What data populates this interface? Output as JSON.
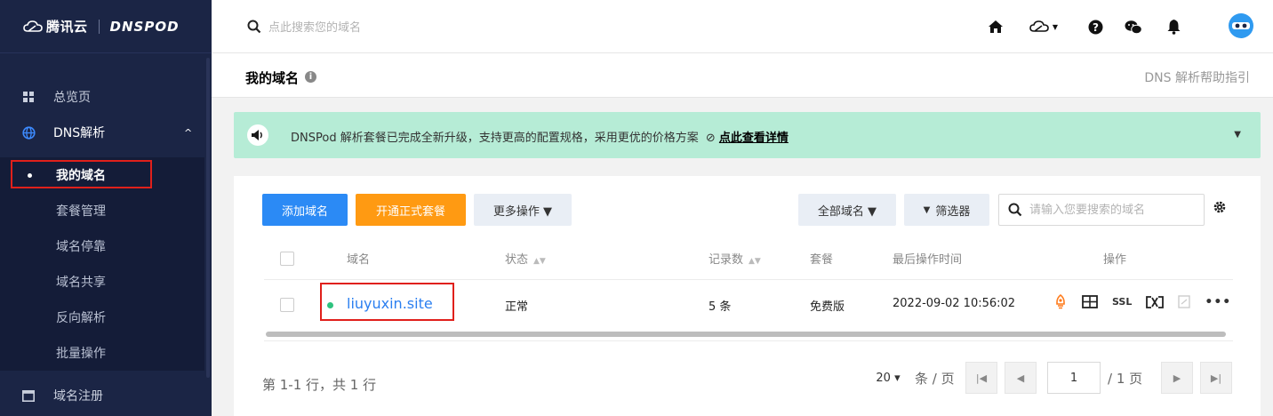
{
  "sidebar": {
    "brand": "腾讯云",
    "product": "DNSPOD",
    "items": [
      {
        "label": "总览页",
        "icon": "grid-icon"
      },
      {
        "label": "DNS解析",
        "icon": "globe-icon"
      },
      {
        "label": "域名注册",
        "icon": "window-icon"
      }
    ],
    "sub_items": [
      {
        "label": "我的域名"
      },
      {
        "label": "套餐管理"
      },
      {
        "label": "域名停靠"
      },
      {
        "label": "域名共享"
      },
      {
        "label": "反向解析"
      },
      {
        "label": "批量操作"
      }
    ]
  },
  "topbar": {
    "search_placeholder": "点此搜索您的域名"
  },
  "page": {
    "title": "我的域名",
    "help_link": "DNS 解析帮助指引"
  },
  "notice": {
    "text": "DNSPod 解析套餐已完成全新升级，支持更高的配置规格，采用更优的价格方案",
    "link": "点此查看详情"
  },
  "toolbar": {
    "add_domain": "添加域名",
    "open_plan": "开通正式套餐",
    "more_actions": "更多操作 ▼",
    "all_domains": "全部域名 ▼",
    "filter": "筛选器",
    "search_placeholder": "请输入您要搜索的域名"
  },
  "table": {
    "headers": {
      "domain": "域名",
      "status": "状态",
      "records": "记录数",
      "plan": "套餐",
      "last_op": "最后操作时间",
      "actions": "操作"
    },
    "rows": [
      {
        "domain": "liuyuxin.site",
        "status": "正常",
        "records": "5 条",
        "plan": "免费版",
        "last_op": "2022-09-02 10:56:02",
        "ssl": "SSL"
      }
    ]
  },
  "pager": {
    "summary": "第 1-1 行，共 1 行",
    "page_size": "20 ▾",
    "per_page": "条 / 页",
    "current": "1",
    "total": "/ 1 页"
  },
  "colors": {
    "sidebar_bg": "#1b2545",
    "accent_blue": "#2b8af5",
    "accent_orange": "#ff9a12",
    "notice_bg": "#b6ecd6",
    "highlight_red": "#e0201b",
    "status_green": "#2ec27e"
  }
}
